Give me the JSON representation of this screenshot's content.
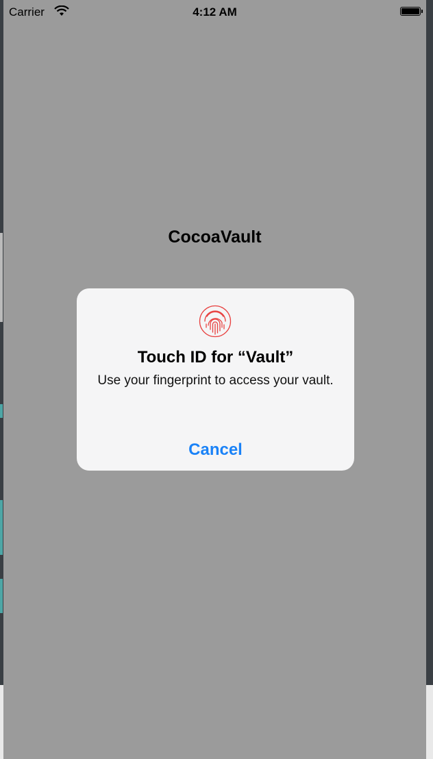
{
  "status_bar": {
    "carrier": "Carrier",
    "time": "4:12 AM"
  },
  "app": {
    "title": "CocoaVault"
  },
  "alert": {
    "icon": "fingerprint-icon",
    "title": "Touch ID for “Vault”",
    "message": "Use your fingerprint to access your vault.",
    "cancel_label": "Cancel"
  },
  "colors": {
    "dim_overlay": "#9b9b9b",
    "alert_background": "#f5f5f6",
    "accent_blue": "#1a82f7",
    "fingerprint_red": "#e8403f"
  }
}
